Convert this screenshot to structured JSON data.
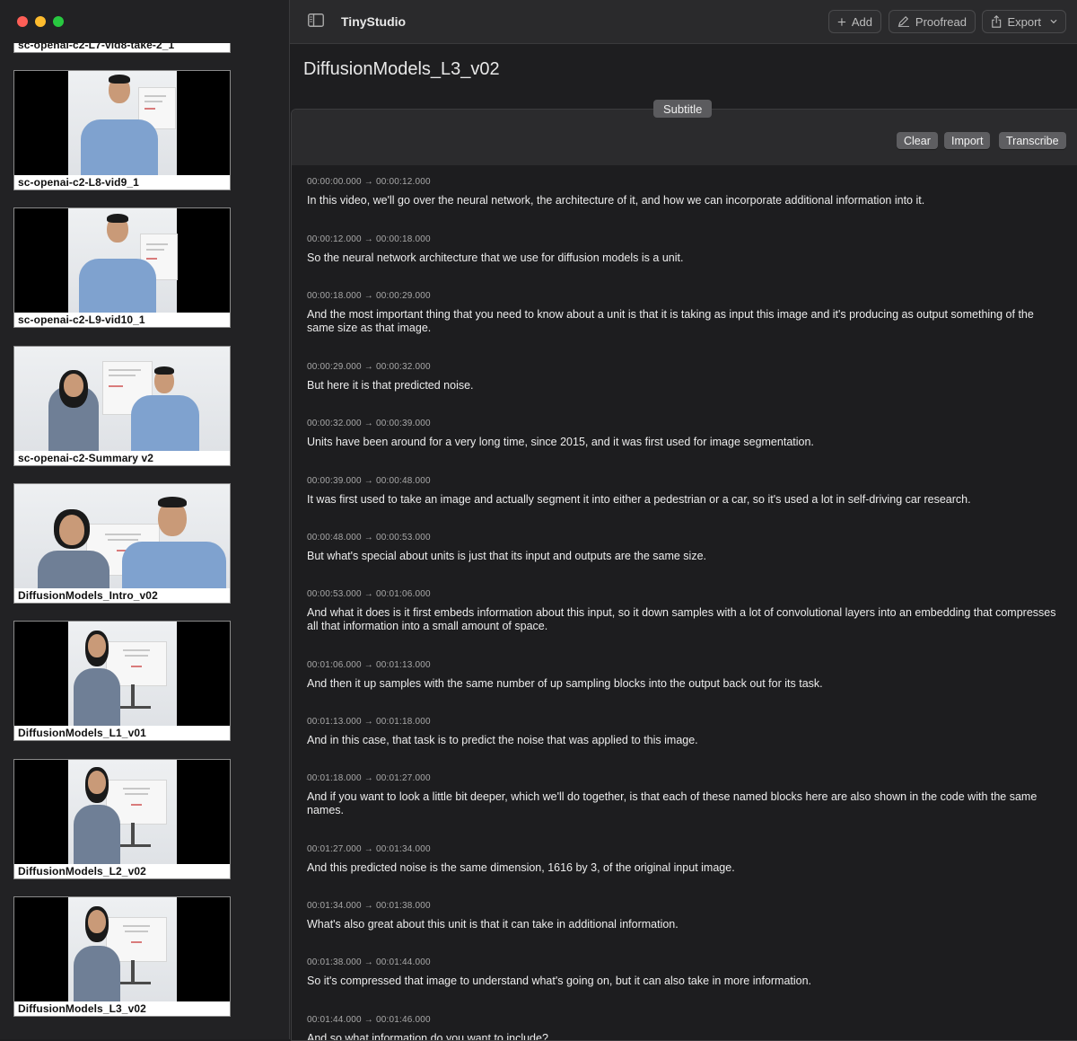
{
  "window": {
    "app_title": "TinyStudio"
  },
  "toolbar": {
    "add_label": "Add",
    "proofread_label": "Proofread",
    "export_label": "Export"
  },
  "sidebar": {
    "videos": [
      {
        "caption": "sc-openai-c2-L7-vid8-take-2_1",
        "style": "boxed"
      },
      {
        "caption": "sc-openai-c2-L8-vid9_1",
        "style": "boxed"
      },
      {
        "caption": "sc-openai-c2-L9-vid10_1",
        "style": "boxed"
      },
      {
        "caption": "sc-openai-c2-Summary v2",
        "style": "full"
      },
      {
        "caption": "DiffusionModels_Intro_v02",
        "style": "full"
      },
      {
        "caption": "DiffusionModels_L1_v01",
        "style": "boxed"
      },
      {
        "caption": "DiffusionModels_L2_v02",
        "style": "boxed"
      },
      {
        "caption": "DiffusionModels_L3_v02",
        "style": "boxed"
      }
    ]
  },
  "document": {
    "title": "DiffusionModels_L3_v02"
  },
  "panel": {
    "tab_label": "Subtitle",
    "clear_label": "Clear",
    "import_label": "Import",
    "transcribe_label": "Transcribe"
  },
  "transcript": [
    {
      "time": "00:00:00.000 → 00:00:12.000",
      "text": "In this video, we'll go over the neural network, the architecture of it, and how we can incorporate additional information into it."
    },
    {
      "time": "00:00:12.000 → 00:00:18.000",
      "text": "So the neural network architecture that we use for diffusion models is a unit."
    },
    {
      "time": "00:00:18.000 → 00:00:29.000",
      "text": "And the most important thing that you need to know about a unit is that it is taking as input this image and it's producing as output something of the same size as that image."
    },
    {
      "time": "00:00:29.000 → 00:00:32.000",
      "text": "But here it is that predicted noise."
    },
    {
      "time": "00:00:32.000 → 00:00:39.000",
      "text": "Units have been around for a very long time, since 2015, and it was first used for image segmentation."
    },
    {
      "time": "00:00:39.000 → 00:00:48.000",
      "text": "It was first used to take an image and actually segment it into either a pedestrian or a car, so it's used a lot in self-driving car research."
    },
    {
      "time": "00:00:48.000 → 00:00:53.000",
      "text": "But what's special about units is just that its input and outputs are the same size."
    },
    {
      "time": "00:00:53.000 → 00:01:06.000",
      "text": "And what it does is it first embeds information about this input, so it down samples with a lot of convolutional layers into an embedding that compresses all that information into a small amount of space."
    },
    {
      "time": "00:01:06.000 → 00:01:13.000",
      "text": "And then it up samples with the same number of up sampling blocks into the output back out for its task."
    },
    {
      "time": "00:01:13.000 → 00:01:18.000",
      "text": "And in this case, that task is to predict the noise that was applied to this image."
    },
    {
      "time": "00:01:18.000 → 00:01:27.000",
      "text": "And if you want to look a little bit deeper, which we'll do together, is that each of these named blocks here are also shown in the code with the same names."
    },
    {
      "time": "00:01:27.000 → 00:01:34.000",
      "text": "And this predicted noise is the same dimension, 1616 by 3, of the original input image."
    },
    {
      "time": "00:01:34.000 → 00:01:38.000",
      "text": "What's also great about this unit is that it can take in additional information."
    },
    {
      "time": "00:01:38.000 → 00:01:44.000",
      "text": "So it's compressed that image to understand what's going on, but it can also take in more information."
    },
    {
      "time": "00:01:44.000 → 00:01:46.000",
      "text": "And so what information do you want to include?"
    }
  ]
}
